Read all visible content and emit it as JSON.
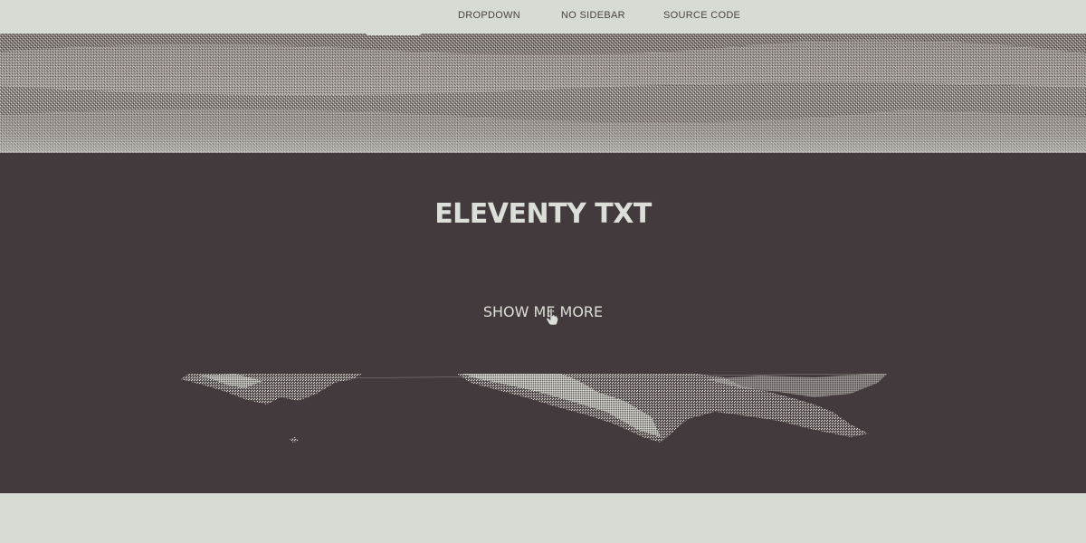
{
  "nav": {
    "items": [
      {
        "label": "DROPDOWN"
      },
      {
        "label": "NO SIDEBAR"
      },
      {
        "label": "SOURCE CODE"
      }
    ]
  },
  "banner": {
    "title": "ELEVENTY TXT",
    "cta_label": "SHOW ME MORE"
  },
  "colors": {
    "background": "#d6dbd3",
    "banner": "#433a3d",
    "text_light": "#dcdfd7",
    "nav_text": "#4c4343"
  }
}
